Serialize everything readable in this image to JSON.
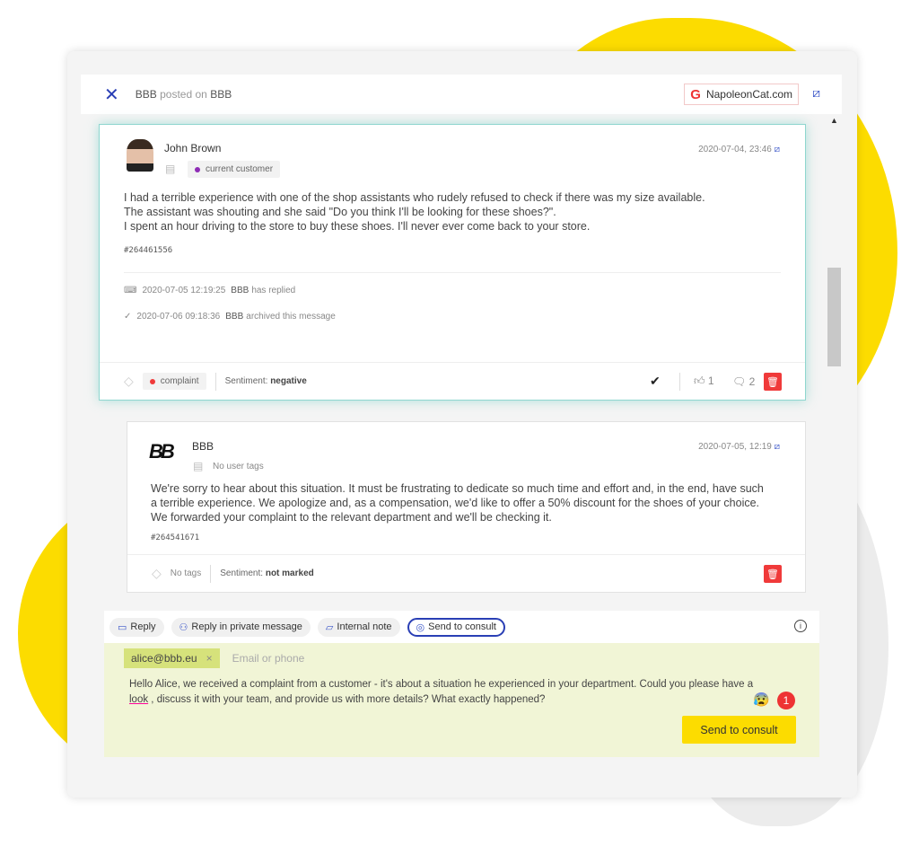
{
  "header": {
    "author": "BBB",
    "posted_on": "posted on",
    "page": "BBB",
    "source": "NapoleonCat.com"
  },
  "post": {
    "author": "John Brown",
    "tag": "current customer",
    "date": "2020-07-04, 23:46",
    "lines": [
      "I had a terrible experience with one of the shop assistants who rudely refused to check if there was my size available.",
      "The assistant was shouting and she said \"Do you think I'll be looking for these shoes?\".",
      "I spent an hour driving to the store to buy these shoes. I'll never ever come back to your store."
    ],
    "id": "#264461556",
    "activity": [
      {
        "time": "2020-07-05 12:19:25",
        "user": "BBB",
        "text": "has replied"
      },
      {
        "time": "2020-07-06 09:18:36",
        "user": "BBB",
        "text": "archived this message"
      }
    ],
    "label": "complaint",
    "sentiment_label": "Sentiment:",
    "sentiment": "negative",
    "likes": "1",
    "comments": "2"
  },
  "reply": {
    "author": "BBB",
    "tag": "No user tags",
    "date": "2020-07-05, 12:19",
    "lines": [
      "We're sorry to hear about this situation. It must be frustrating to dedicate so much time and effort and, in the end, have such",
      "a terrible experience. We apologize and, as a compensation, we'd like to offer a 50% discount for the shoes of your choice.",
      "We forwarded your complaint to the relevant department and we'll be checking it."
    ],
    "id": "#264541671",
    "label": "No tags",
    "sentiment_label": "Sentiment:",
    "sentiment": "not marked"
  },
  "composer": {
    "tabs": [
      "Reply",
      "Reply in private message",
      "Internal note",
      "Send to consult"
    ],
    "active_tab": "Send to consult",
    "recipient": "alice@bbb.eu",
    "placeholder": "Email or phone",
    "message_before": "Hello Alice, we received a complaint from a customer - it's about a situation he experienced in your department. Could you please have a ",
    "message_word": "look",
    "message_after": " , discuss it with your team, and provide us with more details? What exactly happened?",
    "issue_count": "1",
    "send_label": "Send to consult"
  },
  "colors": {
    "accent": "#2a3fb5",
    "brand_yellow": "#fcdc00",
    "delete": "#f03a3a",
    "post_border": "#8fd6cf"
  }
}
